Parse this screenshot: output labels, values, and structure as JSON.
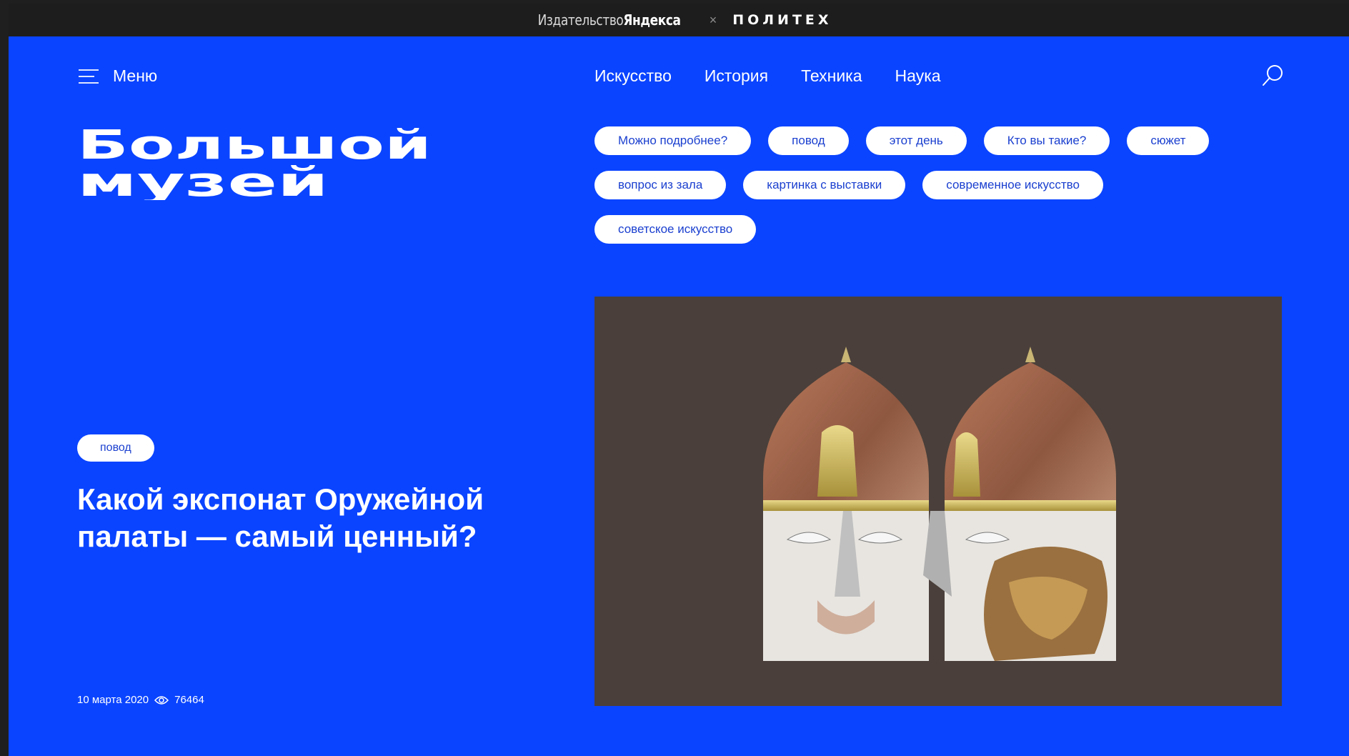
{
  "topbar": {
    "publisher_prefix": "Издательство",
    "publisher_name": "Яндекса",
    "separator": "×",
    "partner": "ПОЛИТЕХ"
  },
  "header": {
    "menu_label": "Меню",
    "nav": [
      "Искусство",
      "История",
      "Техника",
      "Наука"
    ]
  },
  "logo": {
    "line1": "Большой",
    "line2": "музей"
  },
  "tags": {
    "row1": [
      "Можно подробнее?",
      "повод",
      "этот день",
      "Кто вы такие?",
      "сюжет"
    ],
    "row2": [
      "вопрос из зала",
      "картинка с выставки",
      "современное искусство"
    ],
    "row3": [
      "советское искусство"
    ]
  },
  "article": {
    "tag": "повод",
    "title": "Какой экспонат Оружейной палаты — самый ценный?",
    "date": "10 марта 2020",
    "views": "76464"
  },
  "colors": {
    "background": "#0a44ff",
    "topbar": "#1d1d1d",
    "tag_text": "#1a3fcf",
    "image_bg": "#4a3f3a"
  },
  "icons": [
    "menu-icon",
    "search-icon",
    "eye-icon"
  ]
}
